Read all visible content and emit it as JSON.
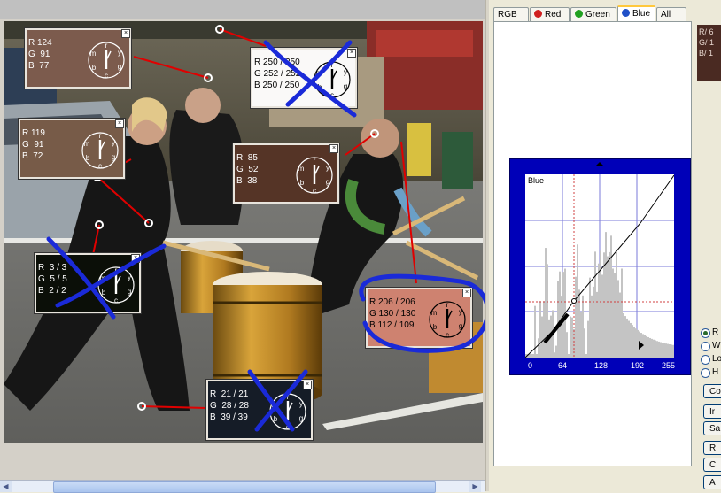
{
  "tabs": [
    {
      "label": "RGB",
      "dot": ""
    },
    {
      "label": "Red",
      "dot": "#d02020"
    },
    {
      "label": "Green",
      "dot": "#20a020"
    },
    {
      "label": "Blue",
      "dot": "#2050c8",
      "active": true
    },
    {
      "label": "All",
      "dot": ""
    }
  ],
  "curves": {
    "channel_label": "Blue",
    "x_ticks": [
      "0",
      "64",
      "128",
      "192",
      "255"
    ]
  },
  "preview": {
    "lines": [
      "R/ 6",
      "G/ 1",
      "B/ 1"
    ]
  },
  "radios": [
    {
      "label": "R",
      "selected": true
    },
    {
      "label": "W",
      "selected": false
    },
    {
      "label": "Lo",
      "selected": false
    },
    {
      "label": "H",
      "selected": false
    }
  ],
  "side_buttons": [
    "Co",
    "Ir",
    "Sa",
    "R",
    "C",
    "A"
  ],
  "samples": [
    {
      "r": "R 124",
      "g": "G  91",
      "b": "B  77",
      "color": "#7c5b4d",
      "text": "#ffffff",
      "crossed": false
    },
    {
      "r": "R 250 / 250",
      "g": "G 252 / 252",
      "b": "B 250 / 250",
      "color": "#faf9f8",
      "text": "#000000",
      "crossed": true
    },
    {
      "r": "R 119",
      "g": "G  91",
      "b": "B  72",
      "color": "#775b48",
      "text": "#ffffff",
      "crossed": false
    },
    {
      "r": "R  85",
      "g": "G  52",
      "b": "B  38",
      "color": "#553426",
      "text": "#ffffff",
      "crossed": false
    },
    {
      "r": "R  3 / 3",
      "g": "G  5 / 5",
      "b": "B  2 / 2",
      "color": "#0b0f08",
      "text": "#ffffff",
      "crossed": true
    },
    {
      "r": "R 206 / 206",
      "g": "G 130 / 130",
      "b": "B 112 / 109",
      "color": "#ce8270",
      "text": "#000000",
      "crossed": false
    },
    {
      "r": "R  21 / 21",
      "g": "G  28 / 28",
      "b": "B  39 / 39",
      "color": "#151c27",
      "text": "#ffffff",
      "crossed": true
    }
  ],
  "dial_letters": {
    "r": "r",
    "y": "y",
    "g": "g",
    "c": "c",
    "b": "b",
    "m": "m"
  }
}
